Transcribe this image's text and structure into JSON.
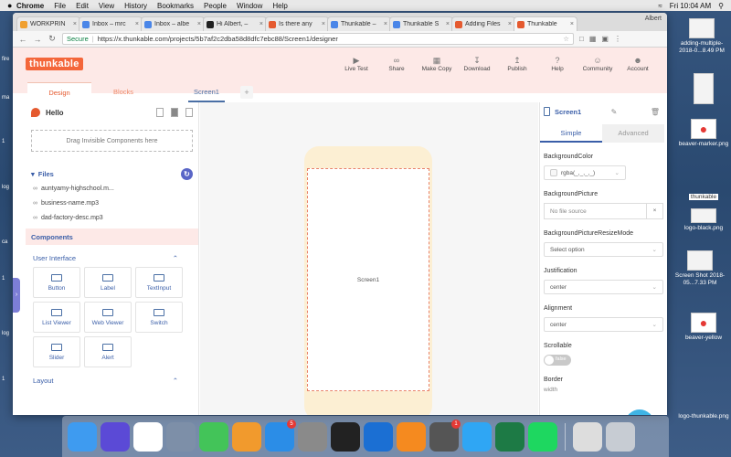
{
  "menubar": {
    "apple": "",
    "items": [
      "Chrome",
      "File",
      "Edit",
      "View",
      "History",
      "Bookmarks",
      "People",
      "Window",
      "Help"
    ],
    "clock": "Fri 10:04 AM"
  },
  "browser": {
    "tabs": [
      {
        "label": "WORKPRIN",
        "color": "#f0a030",
        "active": false
      },
      {
        "label": "Inbox – mrc",
        "color": "#4a86e8",
        "active": false
      },
      {
        "label": "Inbox – albe",
        "color": "#4a86e8",
        "active": false
      },
      {
        "label": "Hi Albert, –",
        "color": "#222222",
        "active": false
      },
      {
        "label": "Is there any",
        "color": "#e55a2f",
        "active": false
      },
      {
        "label": "Thunkable –",
        "color": "#4a86e8",
        "active": false
      },
      {
        "label": "Thunkable S",
        "color": "#4a86e8",
        "active": false
      },
      {
        "label": "Adding Files",
        "color": "#e55a2f",
        "active": false
      },
      {
        "label": "Thunkable",
        "color": "#e55a2f",
        "active": true
      }
    ],
    "user": "Albert",
    "secure_label": "Secure",
    "url": "https://x.thunkable.com/projects/5b7af2c2dba58d8dfc7ebc88/Screen1/designer"
  },
  "app": {
    "logo": "thunkable",
    "nav_actions": [
      {
        "label": "Live Test",
        "icon": "play-icon"
      },
      {
        "label": "Share",
        "icon": "share-icon"
      },
      {
        "label": "Make Copy",
        "icon": "copy-icon"
      },
      {
        "label": "Download",
        "icon": "download-icon"
      },
      {
        "label": "Publish",
        "icon": "publish-icon"
      },
      {
        "label": "Help",
        "icon": "help-icon"
      },
      {
        "label": "Community",
        "icon": "community-icon"
      },
      {
        "label": "Account",
        "icon": "account-icon"
      }
    ],
    "tabs": {
      "design": "Design",
      "blocks": "Blocks",
      "screen": "Screen1",
      "add": "+"
    },
    "left": {
      "project_name": "Hello",
      "dropzone": "Drag Invisible Components here",
      "files_header": "Files",
      "files": [
        "auntyamy-highschool.m...",
        "business-name.mp3",
        "dad-factory-desc.mp3"
      ],
      "components_header": "Components",
      "category_ui": "User Interface",
      "components": [
        "Button",
        "Label",
        "TextInput",
        "List Viewer",
        "Web Viewer",
        "Switch",
        "Slider",
        "Alert"
      ],
      "category_layout": "Layout"
    },
    "canvas": {
      "screen_label": "Screen1"
    },
    "right": {
      "component": "Screen1",
      "tab_simple": "Simple",
      "tab_advanced": "Advanced",
      "bg_color_label": "BackgroundColor",
      "bg_color_value": "rgba(_,_,_,_)",
      "bg_picture_label": "BackgroundPicture",
      "bg_picture_value": "No file source",
      "resize_label": "BackgroundPictureResizeMode",
      "resize_value": "Select option",
      "justification_label": "Justification",
      "justification_value": "center",
      "alignment_label": "Alignment",
      "alignment_value": "center",
      "scrollable_label": "Scrollable",
      "scrollable_value": "false",
      "border_label": "Border",
      "border_sub": "width"
    }
  },
  "desktop": {
    "icons": [
      {
        "label": "adding-multiple-2018-0...8.49 PM",
        "id": "shot1"
      },
      {
        "label": "",
        "id": "small1"
      },
      {
        "label": "beaver-marker.png",
        "id": "beaver1"
      },
      {
        "label": "thunkable",
        "id": "thunk"
      },
      {
        "label": "logo-black.png",
        "id": "logo"
      },
      {
        "label": "Screen Shot 2018-05...7.33 PM",
        "id": "shot2"
      },
      {
        "label": "beaver-yellow",
        "id": "beaver2"
      },
      {
        "label": "logo-thunkable.png",
        "id": "logo2"
      }
    ],
    "left_strip": [
      "fire",
      "ma",
      "1",
      "log",
      "ca",
      "1",
      "log",
      "1"
    ]
  },
  "dock": {
    "apps": [
      {
        "name": "Finder",
        "color": "#3e9bf0"
      },
      {
        "name": "Siri",
        "color": "#5b4ad6"
      },
      {
        "name": "Chrome",
        "color": "#ffffff"
      },
      {
        "name": "Launchpad",
        "color": "#7d8fa8"
      },
      {
        "name": "FaceTime",
        "color": "#43c459"
      },
      {
        "name": "Books",
        "color": "#f19a2d"
      },
      {
        "name": "App Store",
        "color": "#2b8de7",
        "badge": "5"
      },
      {
        "name": "System Preferences",
        "color": "#8a8a8a"
      },
      {
        "name": "Activity Monitor",
        "color": "#222222"
      },
      {
        "name": "QuickTime",
        "color": "#1b6fd3"
      },
      {
        "name": "Sublime",
        "color": "#f58a1f"
      },
      {
        "name": "Sublime Text",
        "color": "#555555",
        "badge": "1"
      },
      {
        "name": "Messages",
        "color": "#2fa6f4"
      },
      {
        "name": "Excel",
        "color": "#1d7a45"
      },
      {
        "name": "Spotify",
        "color": "#1ed760"
      },
      {
        "name": "Preview",
        "color": "#dddddd"
      },
      {
        "name": "Trash",
        "color": "#c7ccd3"
      }
    ]
  }
}
